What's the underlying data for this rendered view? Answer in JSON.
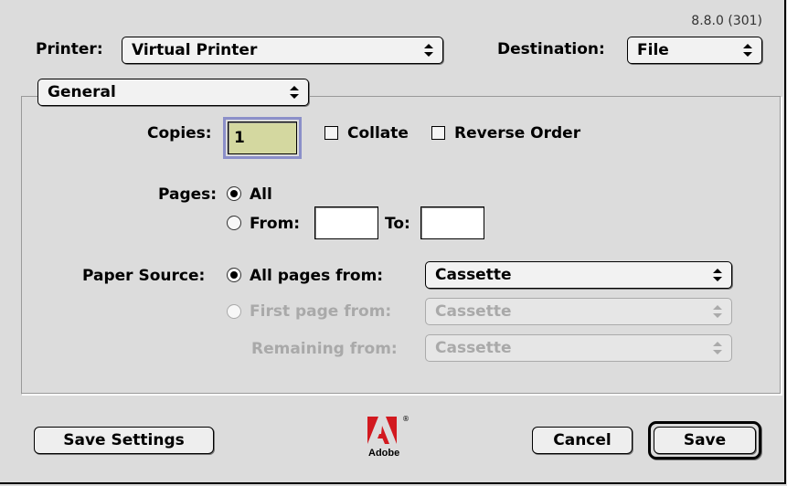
{
  "version": "8.8.0 (301)",
  "header": {
    "printer_label": "Printer:",
    "printer_value": "Virtual Printer",
    "destination_label": "Destination:",
    "destination_value": "File"
  },
  "panel_select": {
    "value": "General"
  },
  "copies": {
    "label": "Copies:",
    "value": "1",
    "collate_label": "Collate",
    "collate_checked": false,
    "reverse_label": "Reverse Order",
    "reverse_checked": false
  },
  "pages": {
    "label": "Pages:",
    "all_label": "All",
    "all_selected": true,
    "from_label": "From:",
    "from_value": "",
    "to_label": "To:",
    "to_value": ""
  },
  "paper_source": {
    "label": "Paper Source:",
    "all_pages_label": "All pages from:",
    "all_pages_value": "Cassette",
    "first_page_label": "First page from:",
    "first_page_value": "Cassette",
    "remaining_label": "Remaining from:",
    "remaining_value": "Cassette"
  },
  "footer": {
    "save_settings_label": "Save Settings",
    "cancel_label": "Cancel",
    "save_label": "Save",
    "logo_text": "Adobe"
  },
  "colors": {
    "background": "#dcdcdc",
    "focus_ring": "#8b8fc9",
    "focused_field": "#d4d8a0",
    "disabled_text": "#a9a9a9",
    "logo_red": "#d2191f"
  },
  "icons": {
    "popup_arrows": "updown-arrows-icon",
    "logo": "adobe-logo-icon"
  }
}
